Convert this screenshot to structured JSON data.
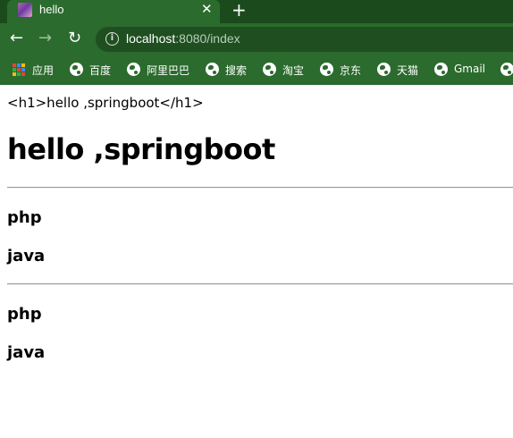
{
  "tab": {
    "title": "hello",
    "close_glyph": "✕",
    "new_tab_glyph": "+"
  },
  "toolbar": {
    "back_glyph": "←",
    "forward_glyph": "→",
    "reload_glyph": "↻",
    "url_host": "localhost",
    "url_rest": ":8080/index"
  },
  "bookmarks": [
    {
      "label": "应用",
      "icon": "apps-grid-icon"
    },
    {
      "label": "百度",
      "icon": "globe-icon"
    },
    {
      "label": "阿里巴巴",
      "icon": "globe-icon"
    },
    {
      "label": "搜索",
      "icon": "globe-icon"
    },
    {
      "label": "淘宝",
      "icon": "globe-icon"
    },
    {
      "label": "京东",
      "icon": "globe-icon"
    },
    {
      "label": "天猫",
      "icon": "globe-icon"
    },
    {
      "label": "Gmail",
      "icon": "globe-icon"
    },
    {
      "label": "",
      "icon": "globe-icon"
    }
  ],
  "page": {
    "raw_text": "<h1>hello ,springboot</h1>",
    "heading": "hello ,springboot",
    "list_a": [
      "php",
      "java"
    ],
    "list_b": [
      "php",
      "java"
    ]
  },
  "colors": {
    "frame_dark": "#1b4a1c",
    "frame": "#2b6b2d",
    "omnibox": "#1f4f20",
    "page_bg": "#ffffff"
  }
}
